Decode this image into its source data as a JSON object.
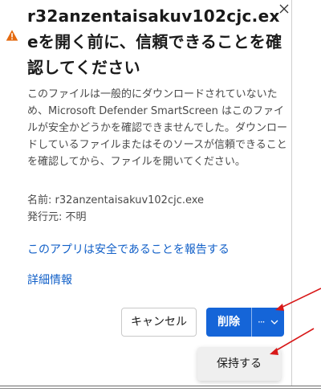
{
  "dialog": {
    "title": "r32anzentaisakuv102cjc.exeを開く前に、信頼できることを確認してください",
    "body": "このファイルは一般的にダウンロードされていないため、Microsoft Defender SmartScreen はこのファイルが安全かどうかを確認できませんでした。ダウンロードしているファイルまたはそのソースが信頼できることを確認してから、ファイルを開いてください。",
    "name_line": "名前: r32anzentaisakuv102cjc.exe",
    "publisher_line": "発行元: 不明",
    "report_link": "このアプリは安全であることを報告する",
    "details_link": "詳細情報",
    "close_icon": "close-icon",
    "warning_icon": "warning-icon"
  },
  "buttons": {
    "cancel": "キャンセル",
    "delete": "削除",
    "more_dots": "···",
    "more_icon": "chevron-down-icon"
  },
  "menu": {
    "keep": "保持する"
  },
  "colors": {
    "accent": "#1565d8",
    "link": "#1260c8",
    "warning": "#e46a10",
    "annotation_arrow": "#d81818"
  }
}
